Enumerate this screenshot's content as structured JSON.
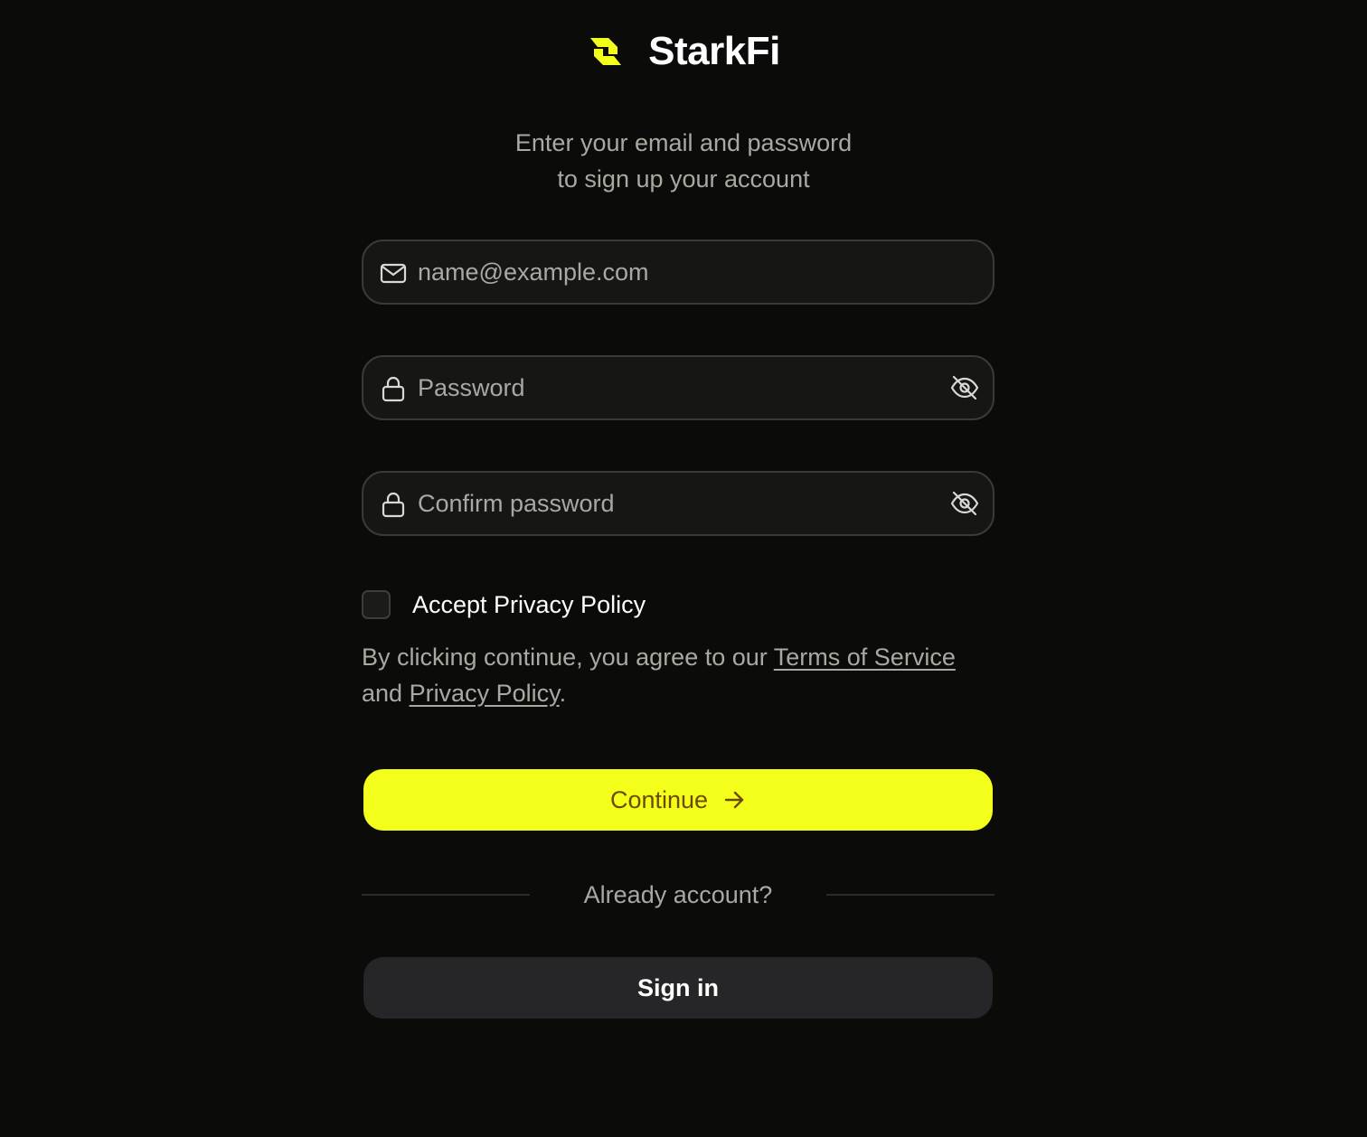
{
  "brand": {
    "name": "StarkFi",
    "accent_color": "#f3ff1a"
  },
  "subtitle": {
    "line1": "Enter your email and password",
    "line2": "to sign up your account"
  },
  "form": {
    "email": {
      "placeholder": "name@example.com",
      "icon": "mail-icon"
    },
    "password": {
      "placeholder": "Password",
      "icon": "lock-icon",
      "toggle_icon": "eye-off-icon"
    },
    "confirm_password": {
      "placeholder": "Confirm password",
      "icon": "lock-icon",
      "toggle_icon": "eye-off-icon"
    },
    "accept_policy": {
      "label": "Accept Privacy Policy",
      "checked": false
    },
    "legal": {
      "prefix": "By clicking continue, you agree to our ",
      "terms_link": "Terms of Service",
      "middle": " and ",
      "privacy_link": "Privacy Policy",
      "suffix": "."
    },
    "continue_button": {
      "label": "Continue",
      "icon": "arrow-right-icon",
      "color": "#f3ff1a",
      "text_color": "#6b4a05"
    },
    "divider_text": "Already account?",
    "signin_button": {
      "label": "Sign in",
      "color": "#262628"
    }
  },
  "background_color": "#0b0c09"
}
